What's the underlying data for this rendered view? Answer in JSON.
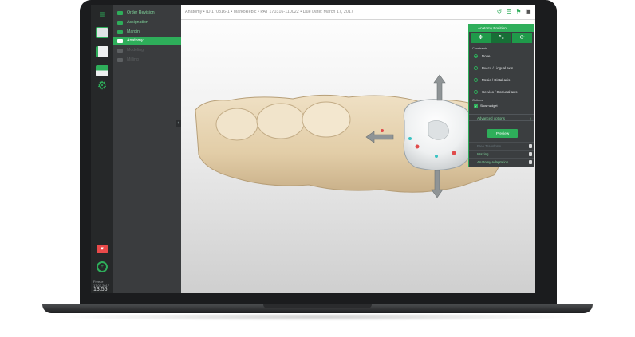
{
  "window": {
    "title": "Anatomy • ID 170316-1 • MarkoRebic • PAT 170316-110022 • Due Date: March 17, 2017"
  },
  "sidebar": {
    "items": [
      {
        "label": "Order Revision",
        "state": "normal",
        "icon": "order-icon"
      },
      {
        "label": "Assignation",
        "state": "normal",
        "icon": "assign-icon"
      },
      {
        "label": "Margin",
        "state": "normal",
        "icon": "margin-icon"
      },
      {
        "label": "Anatomy",
        "state": "active",
        "icon": "anatomy-icon"
      },
      {
        "label": "Modeling",
        "state": "disabled",
        "icon": "modeling-icon"
      },
      {
        "label": "Milling",
        "state": "disabled",
        "icon": "milling-icon"
      }
    ]
  },
  "status": {
    "clock_small": "Freeze",
    "clock_date": "17.03.2017",
    "clock_time": "13:55"
  },
  "panel": {
    "title": "Anatomy Position",
    "constraints_label": "Constraints",
    "options": [
      {
        "label": "None",
        "selected": true
      },
      {
        "label": "Bucco / Lingual axis",
        "selected": false
      },
      {
        "label": "Mesio / Distal axis",
        "selected": false
      },
      {
        "label": "Cervico / Occlusal axis",
        "selected": false
      }
    ],
    "options_label": "Options",
    "show_widget_label": "Show widget",
    "show_widget_checked": true,
    "advanced_label": "Advanced options",
    "preview_label": "Preview",
    "sub_sections": [
      {
        "label": "Free Transform",
        "state": "dim"
      },
      {
        "label": "Waxing",
        "state": "active"
      },
      {
        "label": "Anatomy Adaptation",
        "state": "active"
      }
    ]
  },
  "colors": {
    "accent": "#2eae5a",
    "sidebar_dark": "#262829",
    "nav_panel": "#3a3c3e",
    "alert": "#e94a4a"
  }
}
